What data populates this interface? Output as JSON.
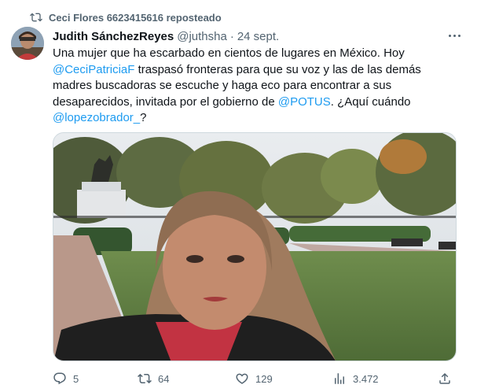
{
  "repost": {
    "text": "Ceci Flores 6623415616 reposteado"
  },
  "tweet": {
    "author_name": "Judith SánchezReyes",
    "handle": "@juthsha",
    "separator": "·",
    "date": "24 sept.",
    "lines": {
      "l1": "Una mujer que ha escarbado en cientos de lugares en México. Hoy",
      "l2_mention": "@CeciPatriciaF",
      "l2_text": " traspasó fronteras para que su voz y las de las demás",
      "l3": "madres buscadoras se escuche y haga eco para encontrar a sus",
      "l4_text": "desaparecidos, invitada por el gobierno de ",
      "l4_mention": "@POTUS",
      "l4_tail": ". ¿Aquí cuándo",
      "l5_mention": "@lopezobrador_",
      "l5_tail": "?"
    }
  },
  "actions": {
    "replies": "5",
    "reposts": "64",
    "likes": "129",
    "views": "3.472"
  },
  "colors": {
    "accent": "#1d9bf0",
    "muted": "#536471",
    "text": "#0f1419"
  },
  "icons": {
    "repost": "repost-icon",
    "more": "more-icon",
    "reply": "reply-icon",
    "like": "heart-icon",
    "views": "views-icon",
    "share": "share-icon"
  }
}
